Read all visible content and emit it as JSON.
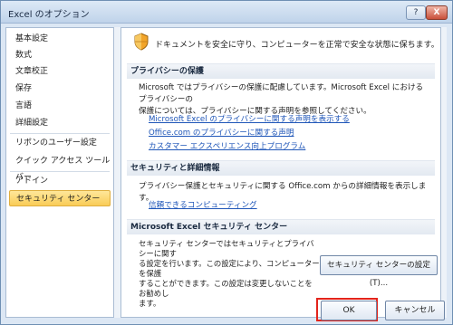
{
  "window": {
    "title": "Excel のオプション",
    "help_label": "?",
    "close_label": "X"
  },
  "nav": {
    "items": [
      {
        "label": "基本設定"
      },
      {
        "label": "数式"
      },
      {
        "label": "文章校正"
      },
      {
        "label": "保存"
      },
      {
        "label": "言語"
      },
      {
        "label": "詳細設定"
      },
      {
        "label": "リボンのユーザー設定"
      },
      {
        "label": "クイック アクセス ツール バー"
      },
      {
        "label": "アドイン"
      },
      {
        "label": "セキュリティ センター",
        "selected": true
      }
    ]
  },
  "content": {
    "intro": "ドキュメントを安全に守り、コンピューターを正常で安全な状態に保ちます。",
    "privacy": {
      "heading": "プライバシーの保護",
      "text_line1": "Microsoft ではプライバシーの保護に配慮しています。Microsoft Excel におけるプライバシーの",
      "text_line2": "保護については、プライバシーに関する声明を参照してください。",
      "links": [
        "Microsoft Excel のプライバシーに関する声明を表示する",
        "Office.com のプライバシーに関する声明",
        "カスタマー エクスペリエンス向上プログラム"
      ]
    },
    "security": {
      "heading": "セキュリティと詳細情報",
      "text": "プライバシー保護とセキュリティに関する Office.com からの詳細情報を表示します。",
      "link": "信頼できるコンピューティング"
    },
    "trust_center": {
      "heading": "Microsoft Excel セキュリティ センター",
      "lines": [
        "セキュリティ センターではセキュリティとプライバシーに関す",
        "る設定を行います。この設定により、コンピューターを保護",
        "することができます。この設定は変更しないことをお勧めし",
        "ます。"
      ],
      "button_label": "セキュリティ センターの設定(T)..."
    }
  },
  "footer": {
    "ok_label": "OK",
    "cancel_label": "キャンセル"
  },
  "colors": {
    "highlight": "#e3241b",
    "selected": "#f9cc57",
    "link": "#1f56b8"
  }
}
